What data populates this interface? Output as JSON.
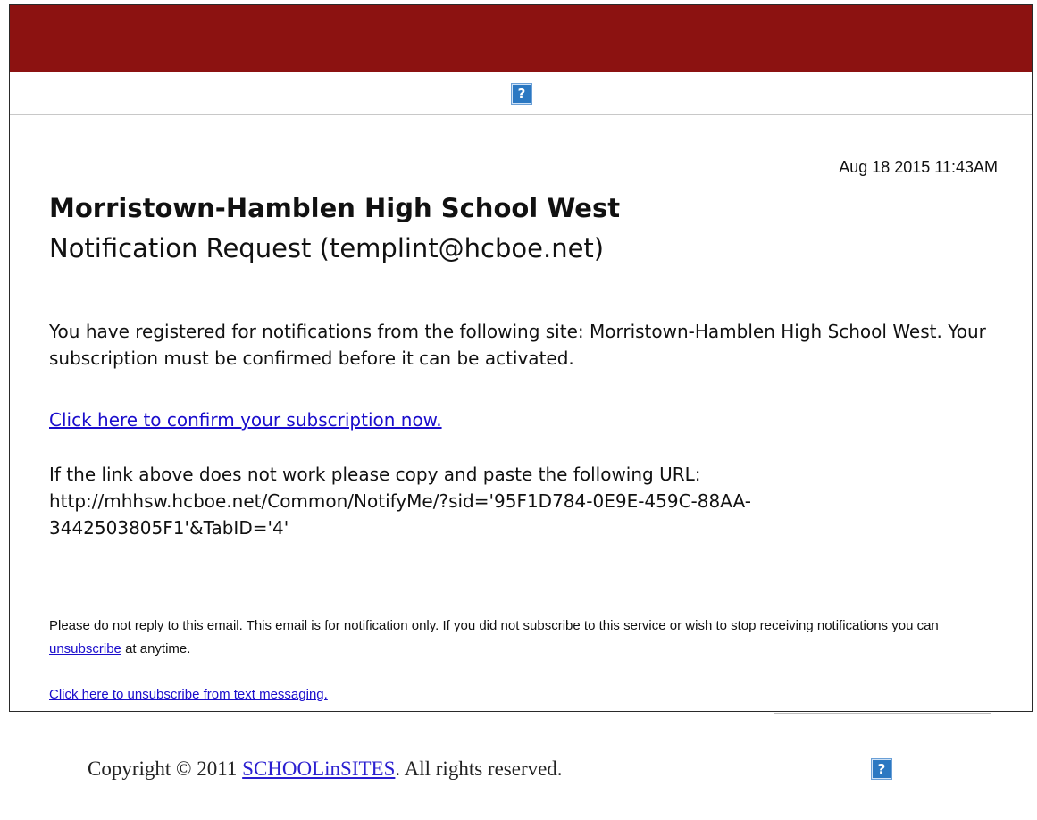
{
  "header": {
    "help_icon": "?"
  },
  "email": {
    "date": "Aug 18 2015 11:43AM",
    "school_name": "Morristown-Hamblen High School West",
    "title": "Notification Request (templint@hcboe.net)",
    "intro": "You have registered for notifications from the following site: Morristown-Hamblen High School West. Your subscription must be confirmed before it can be activated.",
    "confirm_link": "Click here to confirm your subscription now.",
    "url_intro": "If the link above does not work please copy and paste the following URL:",
    "url_line1": "http://mhhsw.hcboe.net/Common/NotifyMe/?sid='95F1D784-0E9E-459C-88AA-",
    "url_line2": "3442503805F1'&TabID='4'",
    "footer_note_before": "Please do not reply to this email. This email is for notification only. If you did not subscribe to this service or wish to stop receiving notifications you can",
    "unsubscribe_link": "unsubscribe",
    "footer_note_after": "at anytime.",
    "text_unsubscribe_link": "Click here to unsubscribe from text messaging."
  },
  "footer": {
    "copyright_before": "Copyright © 2011",
    "copyright_link": "SCHOOLinSITES",
    "copyright_after": ". All rights reserved.",
    "help_icon": "?"
  },
  "colors": {
    "banner": "#8c1211",
    "link": "#1a0dcc",
    "help_icon": "#2b78c2"
  }
}
